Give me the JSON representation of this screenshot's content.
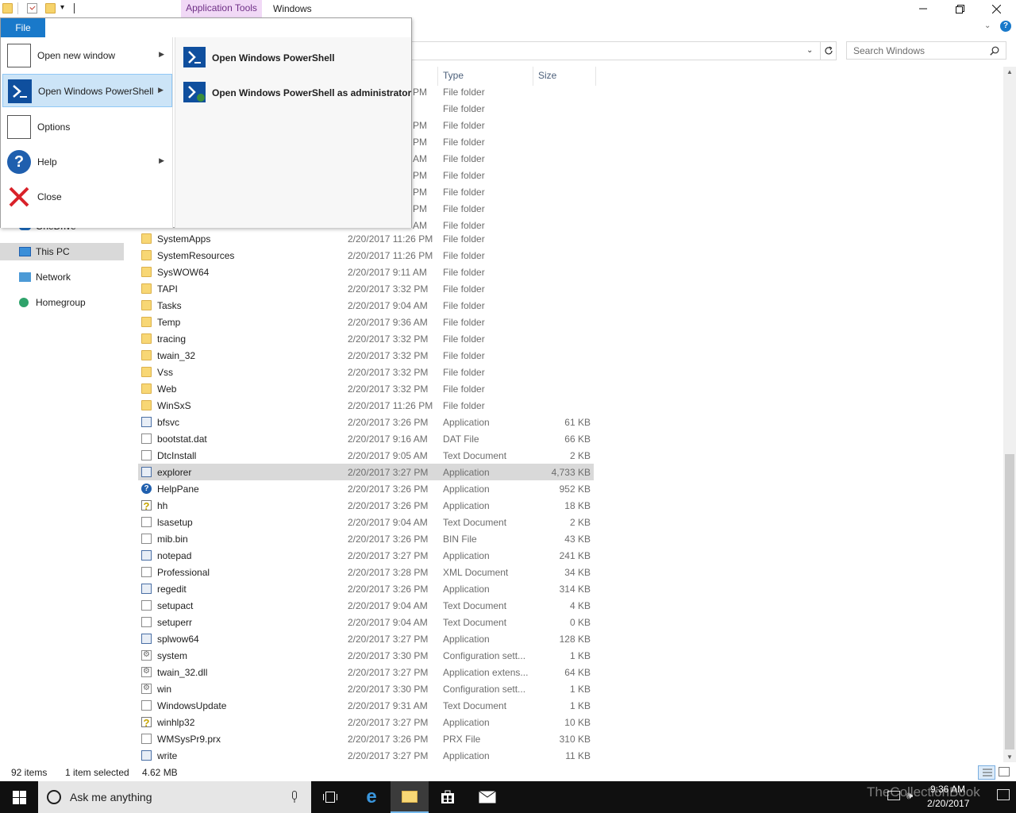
{
  "window": {
    "app_tools_label": "Application Tools",
    "title": "Windows"
  },
  "ribbon": {
    "file_tab": "File"
  },
  "search": {
    "placeholder": "Search Windows"
  },
  "file_menu": {
    "tab_label": "File",
    "items": [
      {
        "label": "Open new window",
        "has_submenu": true,
        "icon": "new-window-icon"
      },
      {
        "label": "Open Windows PowerShell",
        "has_submenu": true,
        "icon": "powershell-icon",
        "highlighted": true
      },
      {
        "label": "Options",
        "has_submenu": false,
        "icon": "options-icon"
      },
      {
        "label": "Help",
        "has_submenu": true,
        "icon": "help-icon"
      },
      {
        "label": "Close",
        "has_submenu": false,
        "icon": "close-icon"
      }
    ],
    "submenu": [
      {
        "label": "Open Windows PowerShell",
        "icon": "powershell-icon"
      },
      {
        "label": "Open Windows PowerShell as administrator",
        "icon": "powershell-admin-icon"
      }
    ]
  },
  "nav": {
    "items": [
      {
        "label": "OneDrive",
        "icon": "onedrive-icon"
      },
      {
        "label": "This PC",
        "icon": "computer-icon",
        "selected": true
      },
      {
        "label": "Network",
        "icon": "network-icon"
      },
      {
        "label": "Homegroup",
        "icon": "homegroup-icon"
      }
    ]
  },
  "columns": {
    "type": "Type",
    "size": "Size"
  },
  "partial_rows": [
    {
      "date_tail": "PM",
      "type": "File folder"
    },
    {
      "date_tail": "",
      "type": "File folder"
    },
    {
      "date_tail": "PM",
      "type": "File folder"
    },
    {
      "date_tail": "PM",
      "type": "File folder"
    },
    {
      "date_tail": "AM",
      "type": "File folder"
    },
    {
      "date_tail": "PM",
      "type": "File folder"
    },
    {
      "date_tail": "PM",
      "type": "File folder"
    },
    {
      "date_tail": "PM",
      "type": "File folder"
    },
    {
      "date_tail": "AM",
      "type": "File folder"
    }
  ],
  "files": [
    {
      "name": "SystemApps",
      "date": "2/20/2017 11:26 PM",
      "type": "File folder",
      "size": "",
      "icon": "folder"
    },
    {
      "name": "SystemResources",
      "date": "2/20/2017 11:26 PM",
      "type": "File folder",
      "size": "",
      "icon": "folder"
    },
    {
      "name": "SysWOW64",
      "date": "2/20/2017 9:11 AM",
      "type": "File folder",
      "size": "",
      "icon": "folder"
    },
    {
      "name": "TAPI",
      "date": "2/20/2017 3:32 PM",
      "type": "File folder",
      "size": "",
      "icon": "folder"
    },
    {
      "name": "Tasks",
      "date": "2/20/2017 9:04 AM",
      "type": "File folder",
      "size": "",
      "icon": "folder"
    },
    {
      "name": "Temp",
      "date": "2/20/2017 9:36 AM",
      "type": "File folder",
      "size": "",
      "icon": "folder"
    },
    {
      "name": "tracing",
      "date": "2/20/2017 3:32 PM",
      "type": "File folder",
      "size": "",
      "icon": "folder"
    },
    {
      "name": "twain_32",
      "date": "2/20/2017 3:32 PM",
      "type": "File folder",
      "size": "",
      "icon": "folder"
    },
    {
      "name": "Vss",
      "date": "2/20/2017 3:32 PM",
      "type": "File folder",
      "size": "",
      "icon": "folder"
    },
    {
      "name": "Web",
      "date": "2/20/2017 3:32 PM",
      "type": "File folder",
      "size": "",
      "icon": "folder"
    },
    {
      "name": "WinSxS",
      "date": "2/20/2017 11:26 PM",
      "type": "File folder",
      "size": "",
      "icon": "folder"
    },
    {
      "name": "bfsvc",
      "date": "2/20/2017 3:26 PM",
      "type": "Application",
      "size": "61 KB",
      "icon": "app"
    },
    {
      "name": "bootstat.dat",
      "date": "2/20/2017 9:16 AM",
      "type": "DAT File",
      "size": "66 KB",
      "icon": "doc"
    },
    {
      "name": "DtcInstall",
      "date": "2/20/2017 9:05 AM",
      "type": "Text Document",
      "size": "2 KB",
      "icon": "doc"
    },
    {
      "name": "explorer",
      "date": "2/20/2017 3:27 PM",
      "type": "Application",
      "size": "4,733 KB",
      "icon": "app",
      "selected": true
    },
    {
      "name": "HelpPane",
      "date": "2/20/2017 3:26 PM",
      "type": "Application",
      "size": "952 KB",
      "icon": "help"
    },
    {
      "name": "hh",
      "date": "2/20/2017 3:26 PM",
      "type": "Application",
      "size": "18 KB",
      "icon": "yhelp"
    },
    {
      "name": "lsasetup",
      "date": "2/20/2017 9:04 AM",
      "type": "Text Document",
      "size": "2 KB",
      "icon": "doc"
    },
    {
      "name": "mib.bin",
      "date": "2/20/2017 3:26 PM",
      "type": "BIN File",
      "size": "43 KB",
      "icon": "doc"
    },
    {
      "name": "notepad",
      "date": "2/20/2017 3:27 PM",
      "type": "Application",
      "size": "241 KB",
      "icon": "app"
    },
    {
      "name": "Professional",
      "date": "2/20/2017 3:28 PM",
      "type": "XML Document",
      "size": "34 KB",
      "icon": "doc"
    },
    {
      "name": "regedit",
      "date": "2/20/2017 3:26 PM",
      "type": "Application",
      "size": "314 KB",
      "icon": "app"
    },
    {
      "name": "setupact",
      "date": "2/20/2017 9:04 AM",
      "type": "Text Document",
      "size": "4 KB",
      "icon": "doc"
    },
    {
      "name": "setuperr",
      "date": "2/20/2017 9:04 AM",
      "type": "Text Document",
      "size": "0 KB",
      "icon": "doc"
    },
    {
      "name": "splwow64",
      "date": "2/20/2017 3:27 PM",
      "type": "Application",
      "size": "128 KB",
      "icon": "app"
    },
    {
      "name": "system",
      "date": "2/20/2017 3:30 PM",
      "type": "Configuration sett...",
      "size": "1 KB",
      "icon": "cfg"
    },
    {
      "name": "twain_32.dll",
      "date": "2/20/2017 3:27 PM",
      "type": "Application extens...",
      "size": "64 KB",
      "icon": "cfg"
    },
    {
      "name": "win",
      "date": "2/20/2017 3:30 PM",
      "type": "Configuration sett...",
      "size": "1 KB",
      "icon": "cfg"
    },
    {
      "name": "WindowsUpdate",
      "date": "2/20/2017 9:31 AM",
      "type": "Text Document",
      "size": "1 KB",
      "icon": "doc"
    },
    {
      "name": "winhlp32",
      "date": "2/20/2017 3:27 PM",
      "type": "Application",
      "size": "10 KB",
      "icon": "yhelp"
    },
    {
      "name": "WMSysPr9.prx",
      "date": "2/20/2017 3:26 PM",
      "type": "PRX File",
      "size": "310 KB",
      "icon": "doc"
    },
    {
      "name": "write",
      "date": "2/20/2017 3:27 PM",
      "type": "Application",
      "size": "11 KB",
      "icon": "app"
    }
  ],
  "status": {
    "item_count": "92 items",
    "selection": "1 item selected",
    "selection_size": "4.62 MB"
  },
  "taskbar": {
    "search_placeholder": "Ask me anything",
    "time": "9:36 AM",
    "date": "2/20/2017",
    "watermark": "TheCollectionBook"
  },
  "colors": {
    "file_tab": "#1979ca",
    "app_tools_bg": "#f1d9f6",
    "selection": "#d9d9d9",
    "menu_highlight": "#cce4f7"
  }
}
